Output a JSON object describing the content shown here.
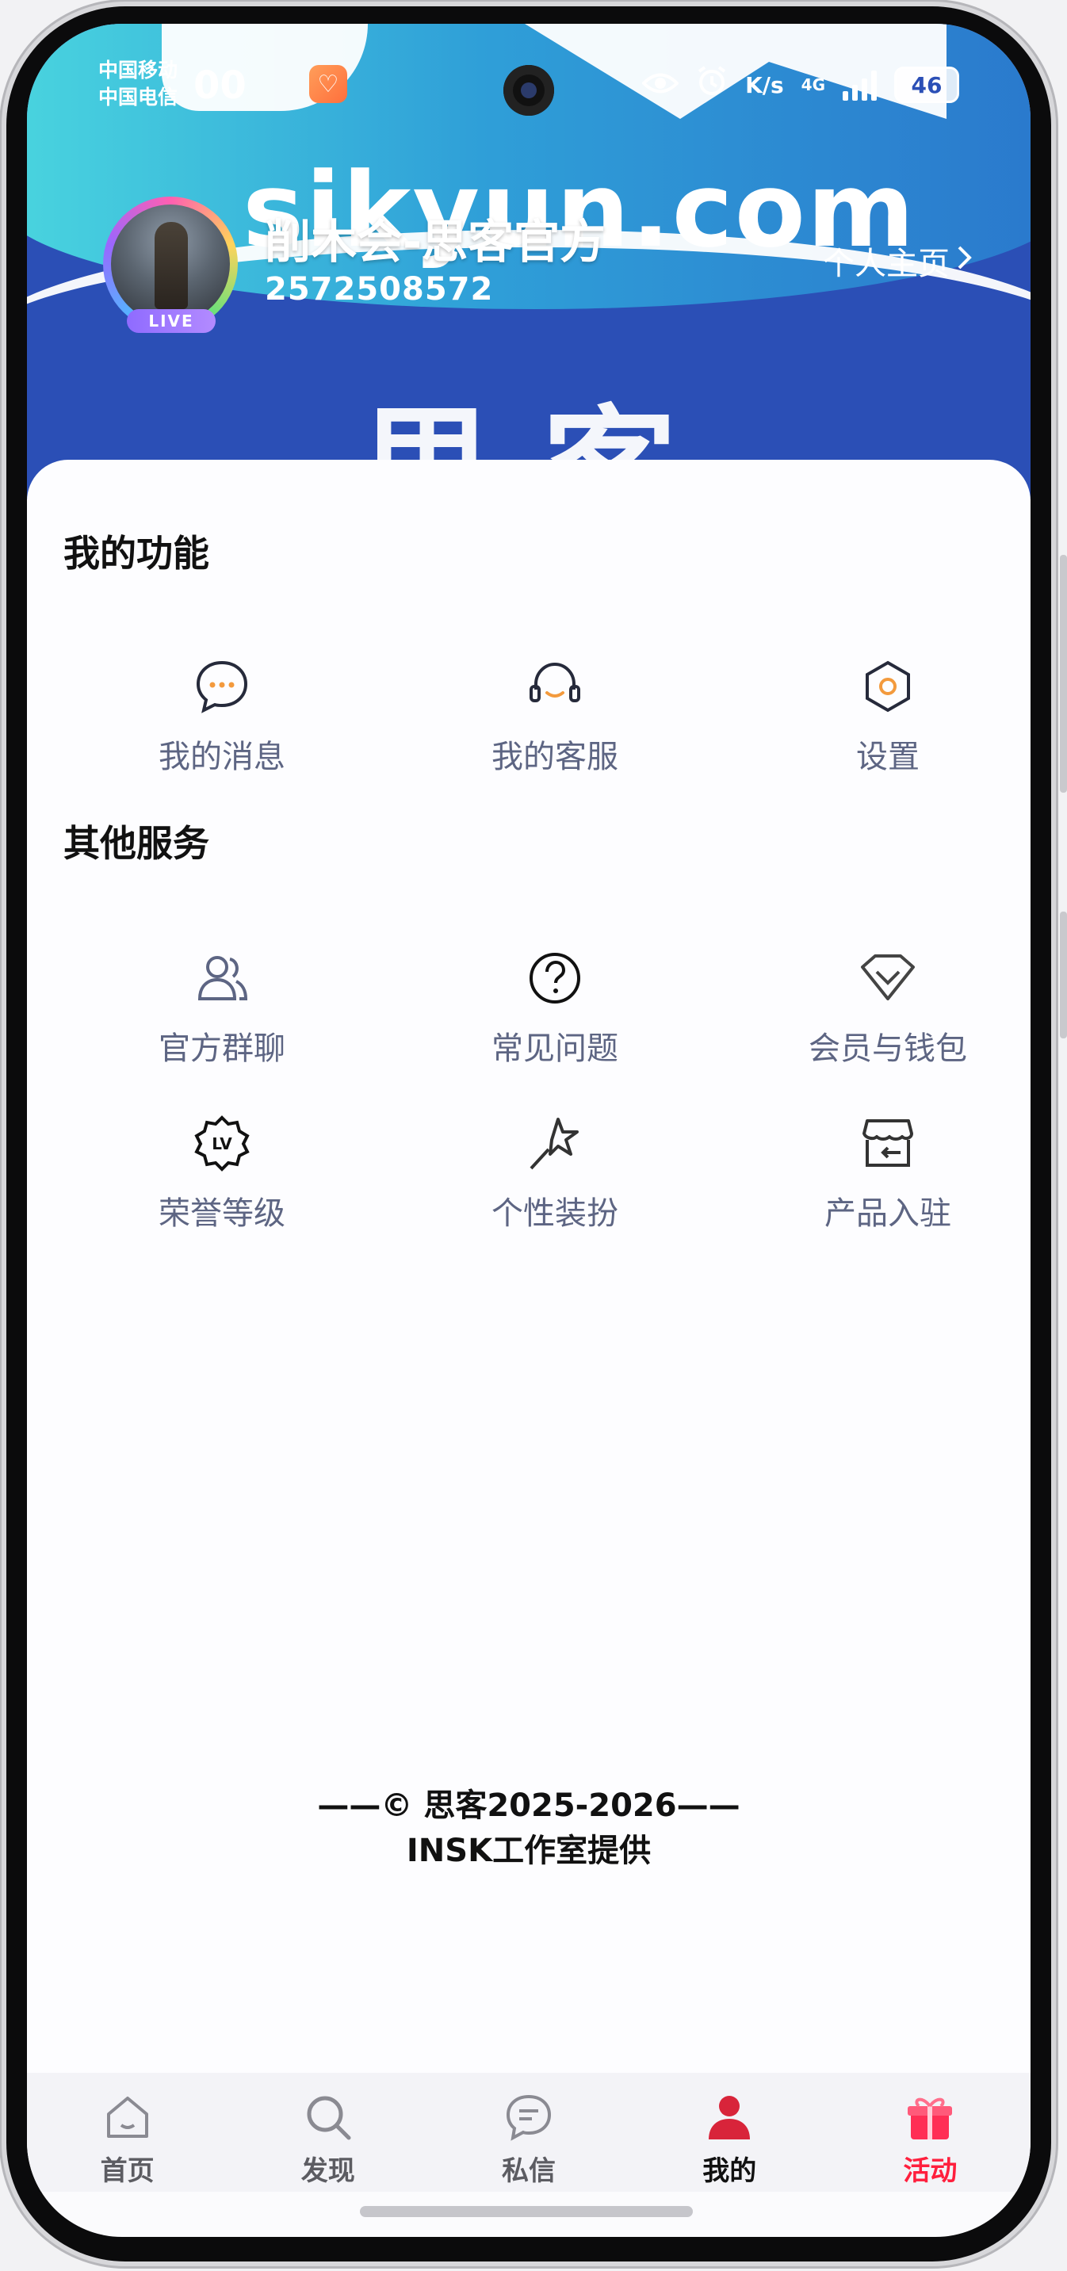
{
  "status_bar": {
    "carrier1": "中国移动",
    "carrier2": "中国电信",
    "time": "00",
    "speed": "K/s",
    "network": "4G",
    "battery": "46"
  },
  "banner": {
    "watermark": "sikyun.com",
    "big_text": "思客"
  },
  "profile": {
    "name": "削木会-思客官方",
    "id": "2572508572",
    "live_badge": "LIVE",
    "homepage_link": "个人主页"
  },
  "sections": {
    "my_functions": {
      "title": "我的功能",
      "items": [
        {
          "label": "我的消息",
          "icon": "chat-bubble-icon"
        },
        {
          "label": "我的客服",
          "icon": "headset-icon"
        },
        {
          "label": "设置",
          "icon": "hexagon-settings-icon"
        }
      ]
    },
    "other_services": {
      "title": "其他服务",
      "items": [
        {
          "label": "官方群聊",
          "icon": "group-icon"
        },
        {
          "label": "常见问题",
          "icon": "question-icon"
        },
        {
          "label": "会员与钱包",
          "icon": "diamond-icon"
        },
        {
          "label": "荣誉等级",
          "icon": "lv-badge-icon"
        },
        {
          "label": "个性装扮",
          "icon": "magic-wand-icon"
        },
        {
          "label": "产品入驻",
          "icon": "store-icon"
        }
      ]
    }
  },
  "footer": {
    "line1": "——© 思客2025-2026——",
    "line2": "INSK工作室提供"
  },
  "tabbar": {
    "items": [
      {
        "label": "首页",
        "icon": "home-icon"
      },
      {
        "label": "发现",
        "icon": "search-icon"
      },
      {
        "label": "私信",
        "icon": "message-icon"
      },
      {
        "label": "我的",
        "icon": "user-icon"
      },
      {
        "label": "活动",
        "icon": "gift-icon"
      }
    ],
    "active_index": 3
  },
  "colors": {
    "banner_blue": "#2b4fb6",
    "label_gray": "#5d6583",
    "accent_orange": "#f39a3d",
    "promo_red": "#ff1f3d"
  }
}
